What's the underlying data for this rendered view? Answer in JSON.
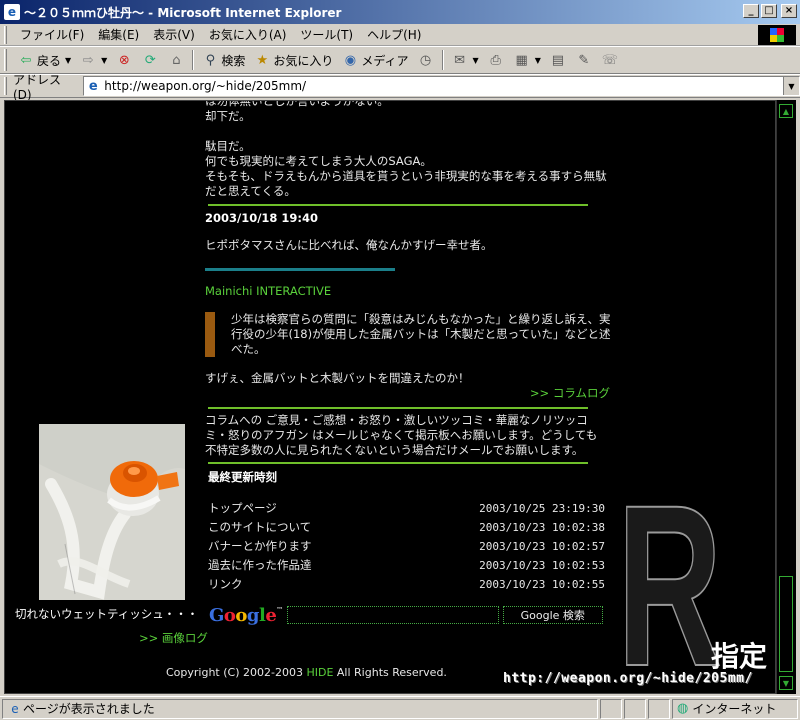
{
  "window": {
    "title": "～２０５ｍｍひ牡丹～ - Microsoft Internet Explorer",
    "buttons": {
      "minimize": "_",
      "maximize": "□",
      "close": "×"
    }
  },
  "menubar": {
    "items": [
      "ファイル(F)",
      "編集(E)",
      "表示(V)",
      "お気に入り(A)",
      "ツール(T)",
      "ヘルプ(H)"
    ]
  },
  "toolbar": {
    "back_label": "戻る",
    "search_label": "検索",
    "favorites_label": "お気に入り",
    "media_label": "メディア"
  },
  "address": {
    "label": "アドレス(D)",
    "url": "http://weapon.org/~hide/205mm/"
  },
  "content": {
    "cut_line": "は勿体無いとしか言いようがない。",
    "block1": [
      "却下だ。",
      "",
      "駄目だ。",
      "何でも現実的に考えてしまう大人のSAGA。",
      "そもそも、ドラえもんから道具を貰うという非現実的な事を考える事すら無駄だと思えてくる。"
    ],
    "entry_date": "2003/10/18 19:40",
    "entry_text": "ヒポポタマスさんに比べれば、俺なんかすげー幸せ者。",
    "source_link": "Mainichi INTERACTIVE",
    "quote": "少年は検察官らの質問に「殺意はみじんもなかった」と繰り返し訴え、実行役の少年(18)が使用した金属バットは「木製だと思っていた」などと述べた。",
    "comment": "すげぇ、金属バットと木製バットを間違えたのか！",
    "column_log": ">> コラムログ",
    "notice": "コラムへの ご意見・ご感想・お怒り・激しいツッコミ・華麗なノリツッコミ・怒りのアフガン はメールじゃなくて掲示板へお願いします。どうしても不特定多数の人に見られたくないという場合だけメールでお願いします。",
    "updates_title": "最終更新時刻",
    "updates": [
      {
        "name": "トップページ",
        "date": "2003/10/25 23:19:30"
      },
      {
        "name": "このサイトについて",
        "date": "2003/10/23 10:02:38"
      },
      {
        "name": "バナーとか作ります",
        "date": "2003/10/23 10:02:57"
      },
      {
        "name": "過去に作った作品達",
        "date": "2003/10/23 10:02:53"
      },
      {
        "name": "リンク",
        "date": "2003/10/23 10:02:55"
      }
    ],
    "google_search_button": "Google 検索",
    "photo_caption": "切れないウェットティッシュ・・・",
    "gallery_link": ">> 画像ログ",
    "copyright_prefix": "Copyright (C) 2002-2003 ",
    "copyright_name": "HIDE",
    "copyright_suffix": " All Rights Reserved.",
    "r_letter": "R",
    "r_label": "指定",
    "r_url": "http://weapon.org/~hide/205mm/"
  },
  "status": {
    "text": "ページが表示されました",
    "zone": "インターネット"
  },
  "colors": {
    "green_link": "#5ad13b",
    "green_rule": "#6fbf2a",
    "teal_rule": "#1b7f8a",
    "quote_bar": "#9a5a10"
  }
}
